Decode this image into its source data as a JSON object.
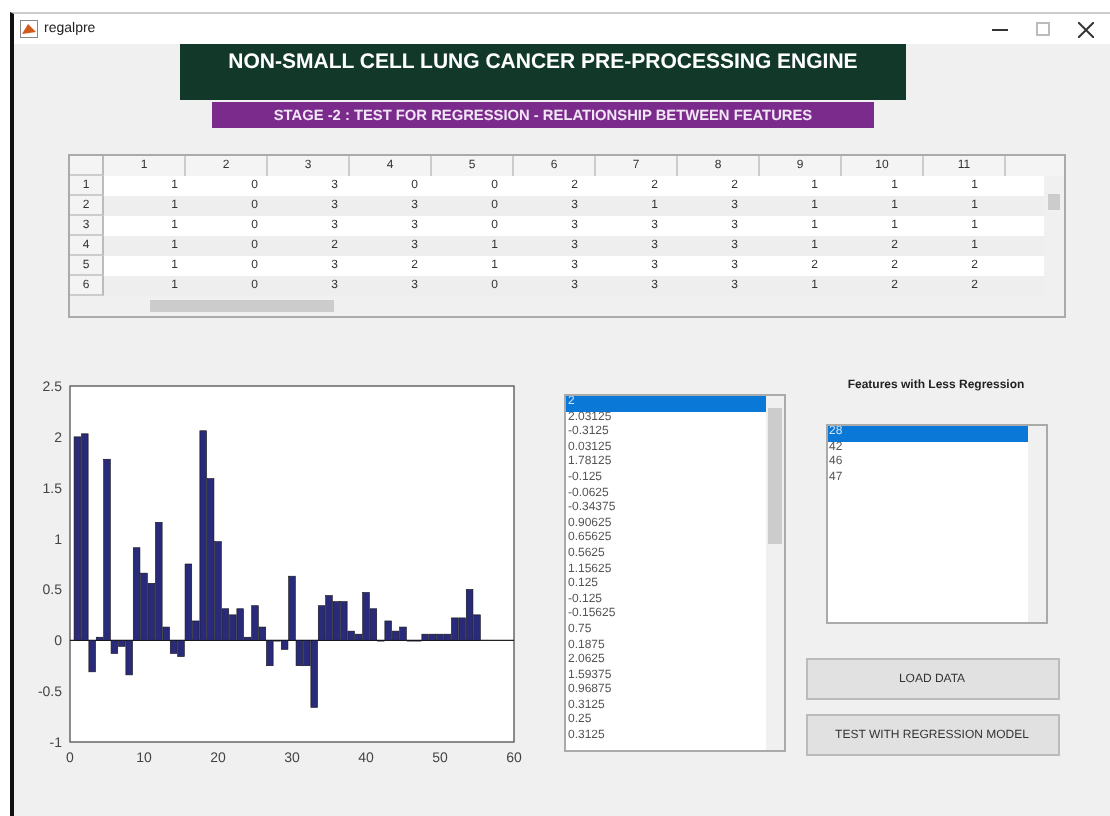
{
  "window": {
    "title": "regalpre"
  },
  "header": {
    "title": "NON-SMALL CELL LUNG CANCER PRE-PROCESSING ENGINE",
    "subtitle": "STAGE -2 : TEST FOR REGRESSION - RELATIONSHIP BETWEEN FEATURES"
  },
  "table": {
    "columns": [
      "1",
      "2",
      "3",
      "4",
      "5",
      "6",
      "7",
      "8",
      "9",
      "10",
      "11"
    ],
    "rows": [
      {
        "header": "1",
        "cells": [
          "1",
          "0",
          "3",
          "0",
          "0",
          "2",
          "2",
          "2",
          "1",
          "1",
          "1"
        ]
      },
      {
        "header": "2",
        "cells": [
          "1",
          "0",
          "3",
          "3",
          "0",
          "3",
          "1",
          "3",
          "1",
          "1",
          "1"
        ]
      },
      {
        "header": "3",
        "cells": [
          "1",
          "0",
          "3",
          "3",
          "0",
          "3",
          "3",
          "3",
          "1",
          "1",
          "1"
        ]
      },
      {
        "header": "4",
        "cells": [
          "1",
          "0",
          "2",
          "3",
          "1",
          "3",
          "3",
          "3",
          "1",
          "2",
          "1"
        ]
      },
      {
        "header": "5",
        "cells": [
          "1",
          "0",
          "3",
          "2",
          "1",
          "3",
          "3",
          "3",
          "2",
          "2",
          "2"
        ]
      },
      {
        "header": "6",
        "cells": [
          "1",
          "0",
          "3",
          "3",
          "0",
          "3",
          "3",
          "3",
          "1",
          "2",
          "2"
        ]
      }
    ]
  },
  "chart": {
    "chart_data": {
      "type": "bar",
      "x": [
        1,
        2,
        3,
        4,
        5,
        6,
        7,
        8,
        9,
        10,
        11,
        12,
        13,
        14,
        15,
        16,
        17,
        18,
        19,
        20,
        21,
        22,
        23,
        24,
        25,
        26,
        27,
        28,
        29,
        30,
        31,
        32,
        33,
        34,
        35,
        36,
        37,
        38,
        39,
        40,
        41,
        42,
        43,
        44,
        45,
        46,
        47,
        48,
        49,
        50,
        51,
        52,
        53,
        54,
        55
      ],
      "series": [
        {
          "color": "#2a2a7a",
          "values": [
            2,
            2.03,
            -0.31,
            0.03,
            1.78,
            -0.13,
            -0.06,
            -0.34,
            0.91,
            0.66,
            0.56,
            1.16,
            0.13,
            -0.13,
            -0.16,
            0.75,
            0.19,
            2.06,
            1.59,
            0.97,
            0.31,
            0.25,
            0.31,
            0.03,
            0.34,
            0.13,
            -0.25,
            0,
            -0.09,
            0.63,
            -0.25,
            -0.25,
            -0.66,
            0.34,
            0.44,
            0.38,
            0.38,
            0.09,
            0.06,
            0.47,
            0.31,
            0,
            0.19,
            0.09,
            0.13,
            0,
            0,
            0.06,
            0.06,
            0.06,
            0.06,
            0.22,
            0.22,
            0.5,
            0.25
          ]
        }
      ],
      "xlim": [
        0,
        60
      ],
      "ylim": [
        -1,
        2.5
      ],
      "xticks": [
        0,
        10,
        20,
        30,
        40,
        50,
        60
      ],
      "yticks": [
        -1,
        -0.5,
        0,
        0.5,
        1,
        1.5,
        2,
        2.5
      ]
    }
  },
  "values_list": {
    "items": [
      {
        "text": "2",
        "selected": true
      },
      {
        "text": "2.03125",
        "selected": false
      },
      {
        "text": "-0.3125",
        "selected": false
      },
      {
        "text": "0.03125",
        "selected": false
      },
      {
        "text": "1.78125",
        "selected": false
      },
      {
        "text": "-0.125",
        "selected": false
      },
      {
        "text": "-0.0625",
        "selected": false
      },
      {
        "text": "-0.34375",
        "selected": false
      },
      {
        "text": "0.90625",
        "selected": false
      },
      {
        "text": "0.65625",
        "selected": false
      },
      {
        "text": "0.5625",
        "selected": false
      },
      {
        "text": "1.15625",
        "selected": false
      },
      {
        "text": "0.125",
        "selected": false
      },
      {
        "text": "-0.125",
        "selected": false
      },
      {
        "text": "-0.15625",
        "selected": false
      },
      {
        "text": "0.75",
        "selected": false
      },
      {
        "text": "0.1875",
        "selected": false
      },
      {
        "text": "2.0625",
        "selected": false
      },
      {
        "text": "1.59375",
        "selected": false
      },
      {
        "text": "0.96875",
        "selected": false
      },
      {
        "text": "0.3125",
        "selected": false
      },
      {
        "text": "0.25",
        "selected": false
      },
      {
        "text": "0.3125",
        "selected": false
      }
    ]
  },
  "features": {
    "label": "Features with Less Regression",
    "items": [
      {
        "text": "28",
        "selected": true
      },
      {
        "text": "42",
        "selected": false
      },
      {
        "text": "46",
        "selected": false
      },
      {
        "text": "47",
        "selected": false
      }
    ]
  },
  "buttons": [
    "LOAD DATA",
    "TEST WITH REGRESSION MODEL"
  ]
}
